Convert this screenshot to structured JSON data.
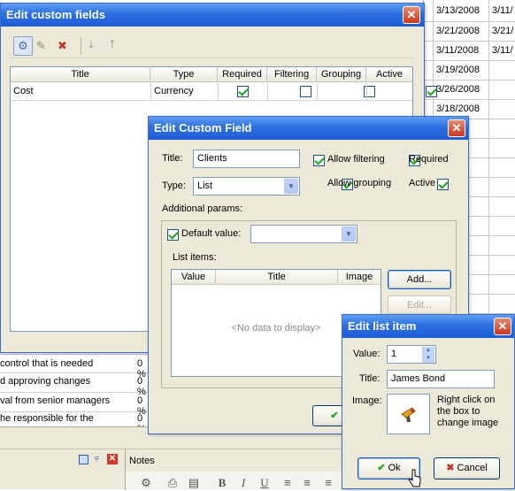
{
  "bg_dates": {
    "col1": [
      "3/13/2008",
      "3/21/2008",
      "3/11/2008",
      "3/19/2008",
      "3/26/2008",
      "3/18/2008"
    ],
    "col2": [
      "3/11/",
      "3/21/",
      "3/11/"
    ]
  },
  "bg_tasks": [
    {
      "text": "control that is needed",
      "pct": "0 %"
    },
    {
      "text": "d approving changes",
      "pct": "0 %"
    },
    {
      "text": "val from senior managers",
      "pct": "0 %"
    },
    {
      "text": "he responsible for the",
      "pct": "0 %"
    }
  ],
  "bottom_panel": {
    "notes_label": "Notes"
  },
  "custom_fields_window": {
    "title": "Edit custom fields",
    "columns": [
      "Title",
      "Type",
      "Required",
      "Filtering",
      "Grouping",
      "Active"
    ],
    "rows": [
      {
        "title": "Cost",
        "type": "Currency",
        "required": true,
        "filtering": false,
        "grouping": false,
        "active": true
      }
    ]
  },
  "edit_field_dialog": {
    "title": "Edit Custom Field",
    "title_label": "Title:",
    "title_value": "Clients",
    "type_label": "Type:",
    "type_value": "List",
    "allow_filtering": "Allow filtering",
    "required": "Required",
    "allow_grouping": "Allow grouping",
    "active": "Active",
    "additional_params": "Additional params:",
    "default_value": "Default value:",
    "list_items": "List items:",
    "list_columns": [
      "Value",
      "Title",
      "Image"
    ],
    "empty_text": "<No data to display>",
    "add_button": "Add...",
    "edit_button": "Edit..."
  },
  "list_item_dialog": {
    "title": "Edit list item",
    "value_label": "Value:",
    "value": "1",
    "title_label": "Title:",
    "title_value": "James Bond",
    "image_label": "Image:",
    "image_hint": "Right click on the box to change image",
    "ok_button": "Ok",
    "cancel_button": "Cancel"
  }
}
